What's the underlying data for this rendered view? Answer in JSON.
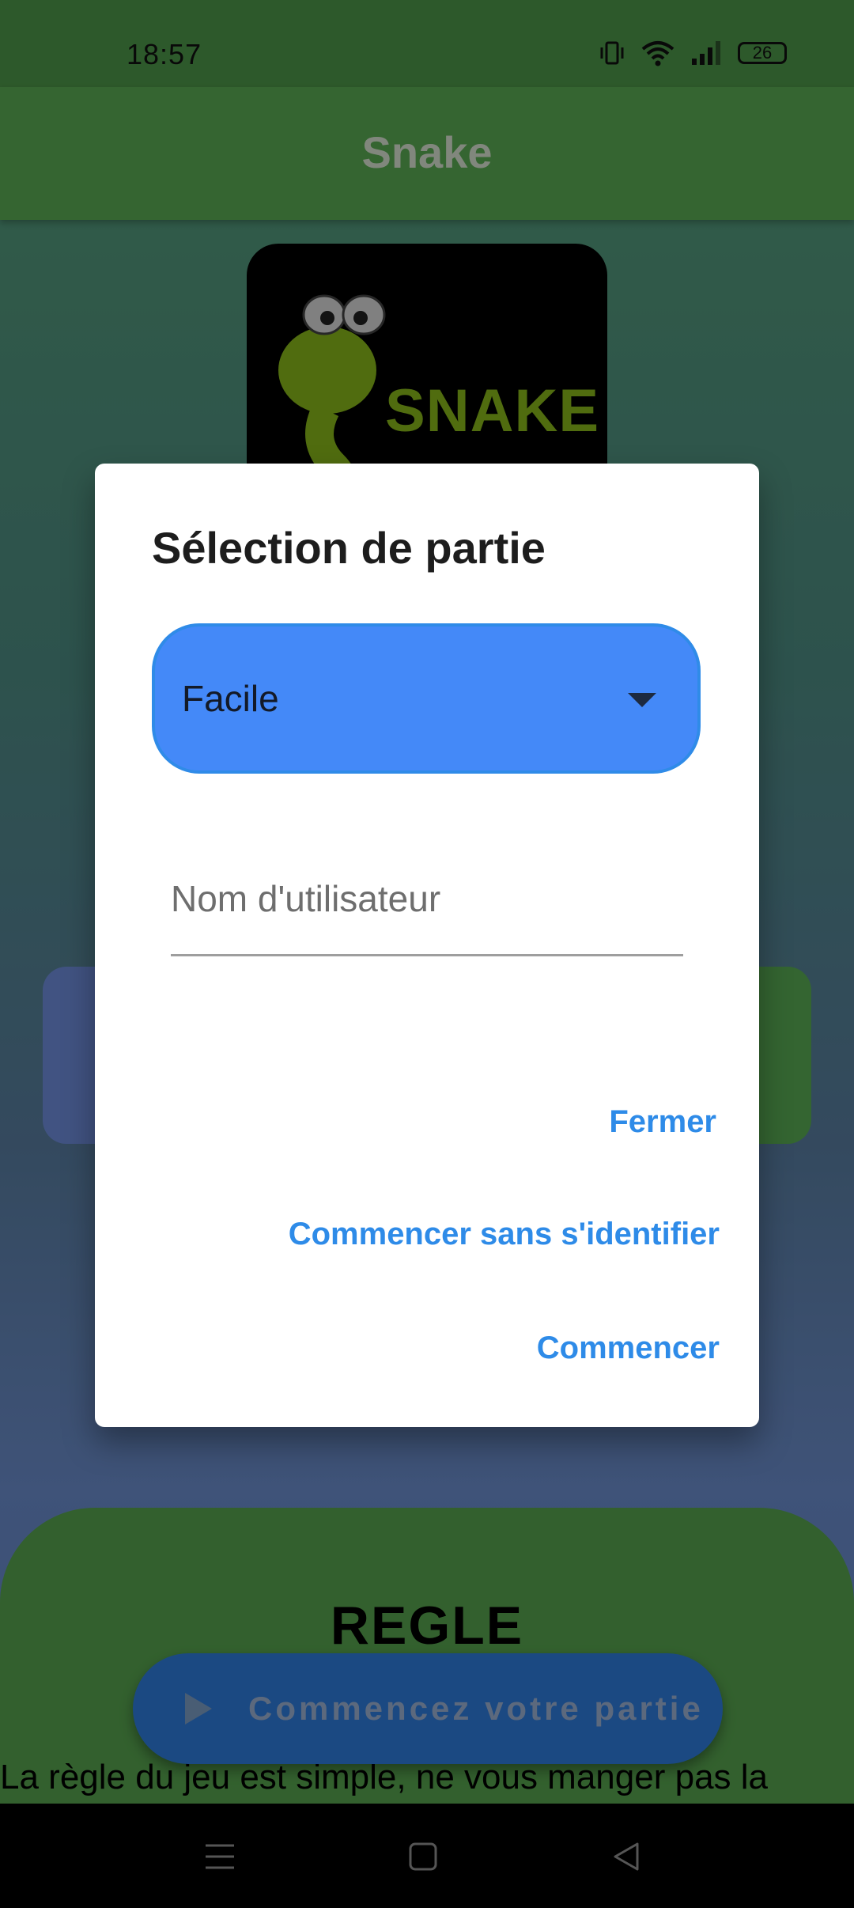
{
  "status_bar": {
    "time": "18:57",
    "battery": "26"
  },
  "app_bar": {
    "title": "Snake"
  },
  "logo": {
    "text": "SNAKE"
  },
  "rules": {
    "title": "REGLE",
    "text": "La règle du jeu est simple, ne vous manger pas la"
  },
  "fab": {
    "label": "Commencez votre partie"
  },
  "dialog": {
    "title": "Sélection de partie",
    "difficulty": {
      "selected": "Facile"
    },
    "username": {
      "placeholder": "Nom d'utilisateur",
      "value": ""
    },
    "buttons": {
      "close": "Fermer",
      "start_anonymous": "Commencer sans s'identifier",
      "start": "Commencer"
    }
  },
  "colors": {
    "accent": "#2e8be8",
    "dropdown_bg": "#4489f8",
    "app_bar": "#5cae55"
  }
}
